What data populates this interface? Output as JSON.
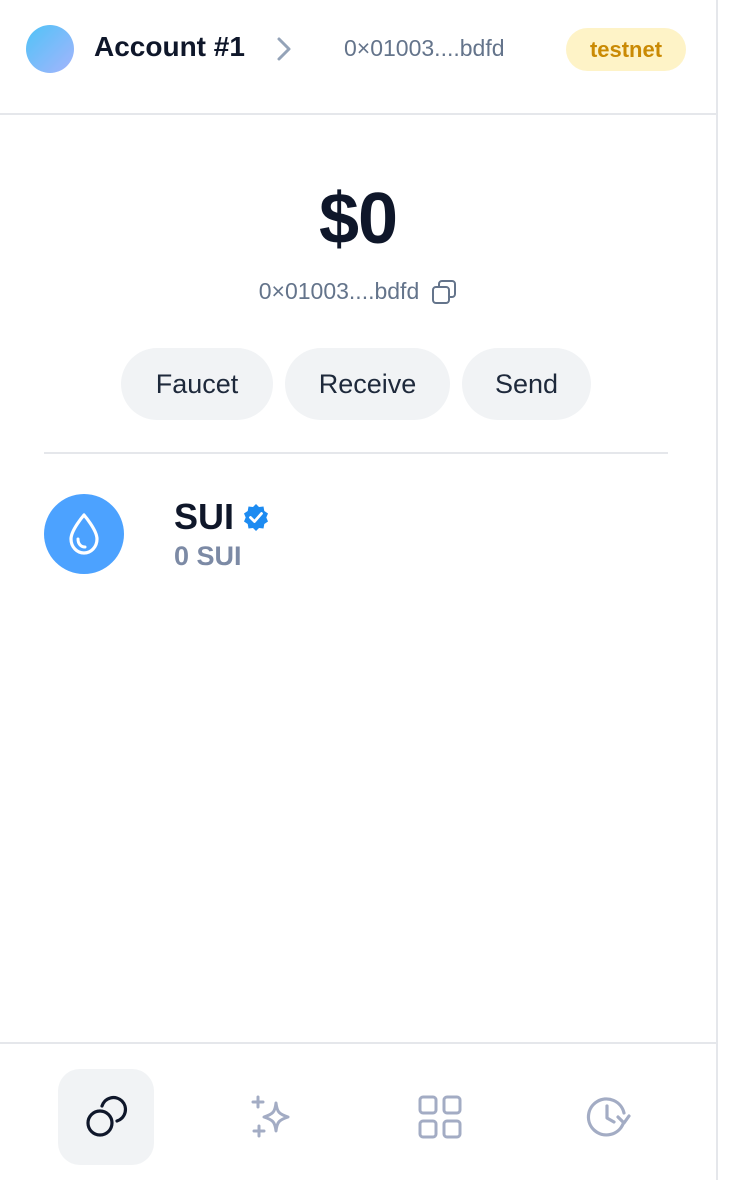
{
  "header": {
    "account_name": "Account #1",
    "address_short": "0×01003....bdfd",
    "network_badge": "testnet"
  },
  "wallet": {
    "balance": "$0",
    "address_short": "0×01003....bdfd"
  },
  "actions": {
    "faucet": "Faucet",
    "receive": "Receive",
    "send": "Send"
  },
  "tokens": [
    {
      "symbol": "SUI",
      "amount": "0 SUI",
      "verified": true,
      "icon": "sui-drop-icon"
    }
  ],
  "nav": {
    "items": [
      {
        "icon": "coins-icon",
        "active": true
      },
      {
        "icon": "sparkle-icon",
        "active": false
      },
      {
        "icon": "apps-grid-icon",
        "active": false
      },
      {
        "icon": "history-clock-icon",
        "active": false
      }
    ]
  },
  "colors": {
    "accent_blue": "#4ca2ff",
    "badge_bg": "#fef3c7",
    "badge_text": "#ca8a04",
    "muted_text": "#64748b"
  }
}
